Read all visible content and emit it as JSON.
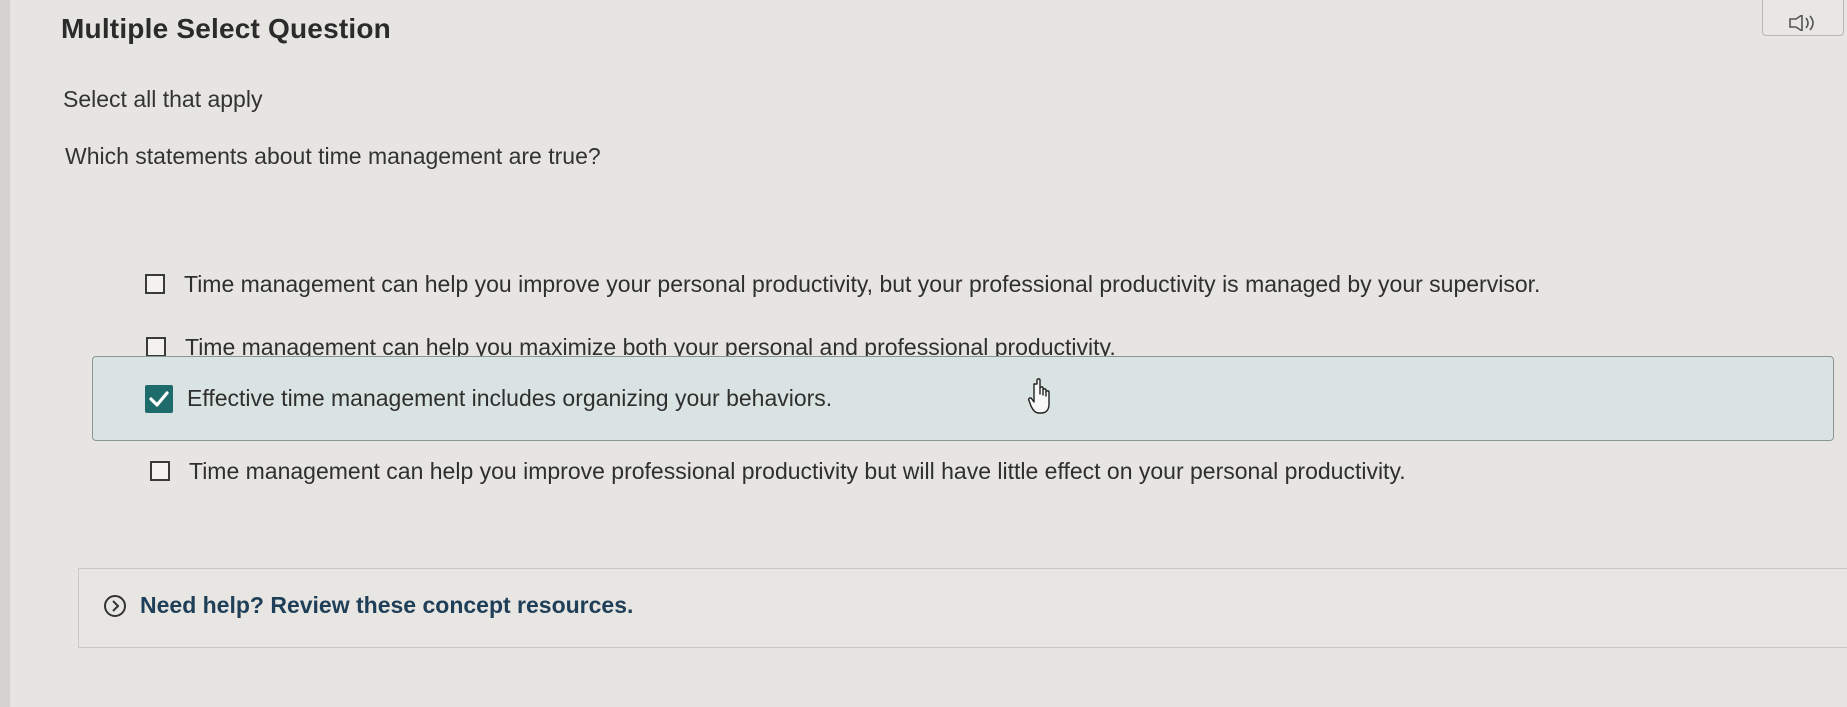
{
  "question": {
    "type_label": "Multiple Select Question",
    "instruction": "Select all that apply",
    "prompt": "Which statements about time management are true?"
  },
  "options": [
    {
      "label": "Time management can help you improve your personal productivity, but your professional productivity is managed by your supervisor.",
      "checked": false
    },
    {
      "label": "Time management can help you maximize both your personal and professional productivity.",
      "checked": false
    },
    {
      "label": "Effective time management includes organizing your behaviors.",
      "checked": true
    },
    {
      "label": "Time management can help you improve professional productivity but will have little effect on your personal productivity.",
      "checked": false
    }
  ],
  "help": {
    "label": "Need help? Review these concept resources.",
    "icon": "chevron-right-circle-icon"
  },
  "top_right": {
    "icon": "speaker-icon"
  },
  "colors": {
    "background": "#e6e5e1",
    "selected_option_bg": "#d9e4e2",
    "checkbox_checked": "#1e6b6b",
    "help_link": "#1f3e57"
  }
}
